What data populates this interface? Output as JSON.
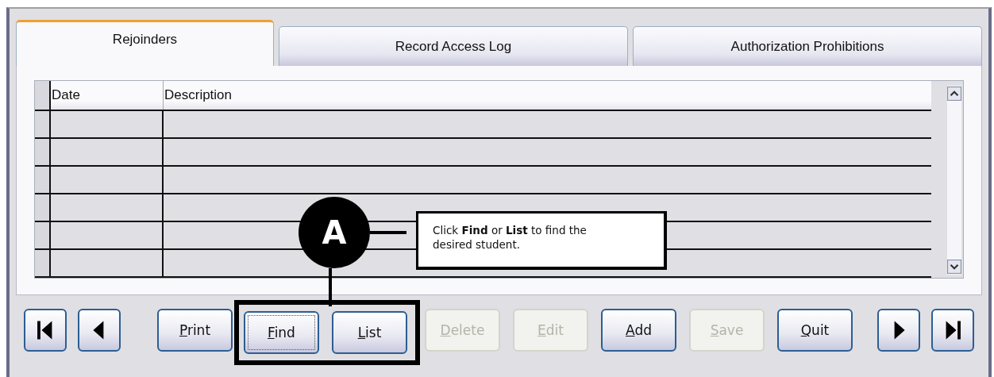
{
  "tabs": [
    {
      "label": "Rejoinders",
      "selected": true
    },
    {
      "label": "Record Access Log",
      "selected": false
    },
    {
      "label": "Authorization Prohibitions",
      "selected": false
    }
  ],
  "table": {
    "columns": [
      "Date",
      "Description"
    ]
  },
  "nav_left": [
    {
      "kind": "first"
    },
    {
      "kind": "prev"
    }
  ],
  "buttons": [
    {
      "label": "Print",
      "disabled": false,
      "focused": false,
      "highlighted": false
    },
    {
      "label": "Find",
      "disabled": false,
      "focused": true,
      "highlighted": true
    },
    {
      "label": "List",
      "disabled": false,
      "focused": false,
      "highlighted": true
    },
    {
      "label": "Delete",
      "disabled": true,
      "focused": false,
      "highlighted": false
    },
    {
      "label": "Edit",
      "disabled": true,
      "focused": false,
      "highlighted": false
    },
    {
      "label": "Add",
      "disabled": false,
      "focused": false,
      "highlighted": false
    },
    {
      "label": "Save",
      "disabled": true,
      "focused": false,
      "highlighted": false
    },
    {
      "label": "Quit",
      "disabled": false,
      "focused": false,
      "highlighted": false
    }
  ],
  "nav_right": [
    {
      "kind": "next"
    },
    {
      "kind": "last"
    }
  ],
  "annotation": {
    "marker": "A",
    "text": "Click **Find** or **List** to find the desired student."
  }
}
